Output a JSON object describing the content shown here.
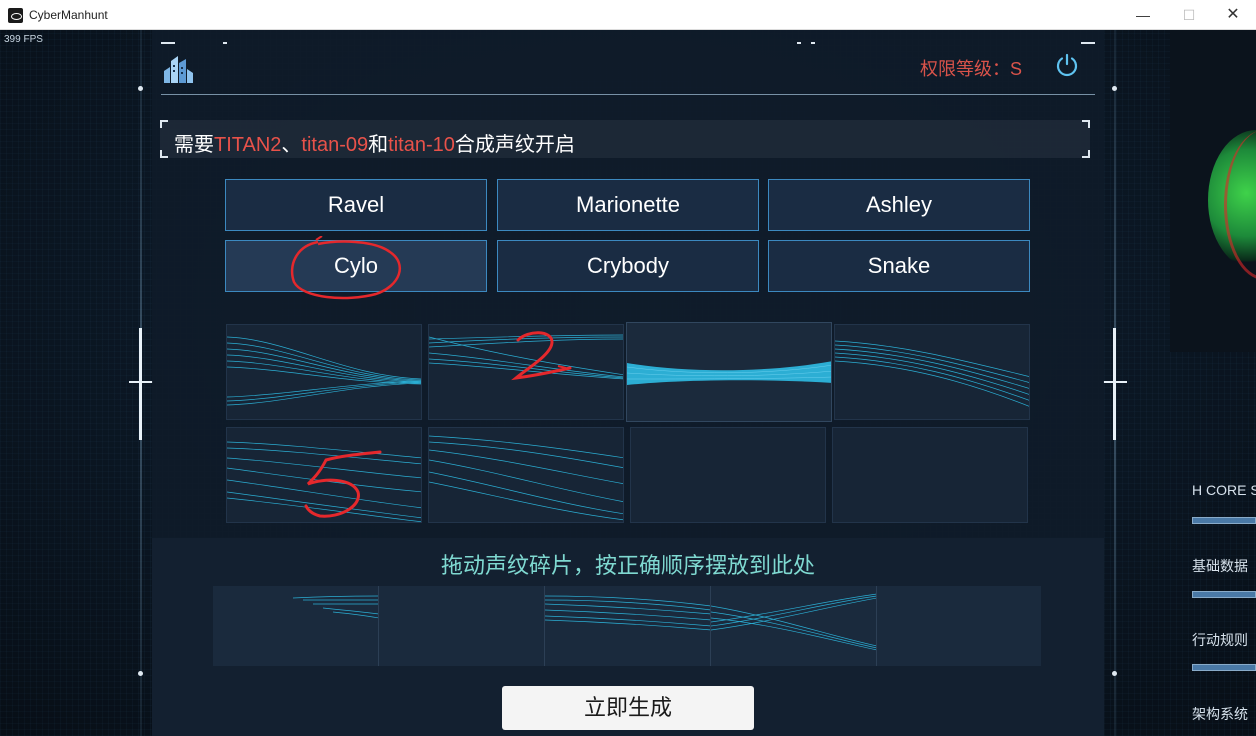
{
  "window": {
    "title": "CyberManhunt",
    "minimize": "—",
    "maximize": "☐",
    "close": "✕"
  },
  "hud": {
    "fps": "399 FPS"
  },
  "header": {
    "auth_label": "权限等级：S",
    "logo_icon": "building-icon",
    "power_icon": "power-icon"
  },
  "hint": {
    "prefix": "需要",
    "name1": "TITAN2",
    "sep1": "、",
    "name2": "titan-09",
    "sep2": "和",
    "name3": "titan-10",
    "suffix": "合成声纹开启"
  },
  "name_buttons": [
    {
      "label": "Ravel"
    },
    {
      "label": "Marionette"
    },
    {
      "label": "Ashley"
    },
    {
      "label": "Cylo",
      "selected": true
    },
    {
      "label": "Crybody"
    },
    {
      "label": "Snake"
    }
  ],
  "fragments": [
    {
      "name": "fragment-1",
      "filled": true
    },
    {
      "name": "fragment-2",
      "filled": true
    },
    {
      "name": "fragment-3",
      "filled": true,
      "lifted": true
    },
    {
      "name": "fragment-4",
      "filled": true
    },
    {
      "name": "fragment-5",
      "filled": true
    },
    {
      "name": "fragment-6",
      "filled": true
    },
    {
      "name": "fragment-7",
      "filled": false
    },
    {
      "name": "fragment-8",
      "filled": false
    }
  ],
  "annotations": {
    "mark_2": "2",
    "mark_5": "5"
  },
  "drop_zone": {
    "label": "拖动声纹碎片，按正确顺序摆放到此处",
    "slots": [
      {
        "name": "slot-1",
        "filled": true
      },
      {
        "name": "slot-2",
        "filled": false
      },
      {
        "name": "slot-3",
        "filled": true
      },
      {
        "name": "slot-4",
        "filled": true
      },
      {
        "name": "slot-5",
        "filled": false
      }
    ]
  },
  "generate_button": {
    "label": "立即生成"
  },
  "right_panel": {
    "labels": [
      "H CORE S",
      "基础数据",
      "行动规则",
      "架构系统"
    ],
    "accent_color": "#4a79a6"
  },
  "colors": {
    "accent_red": "#e8524a",
    "wave_cyan": "#2fc6ef",
    "button_border": "#3c89c0",
    "drop_label": "#7fd9d1"
  }
}
